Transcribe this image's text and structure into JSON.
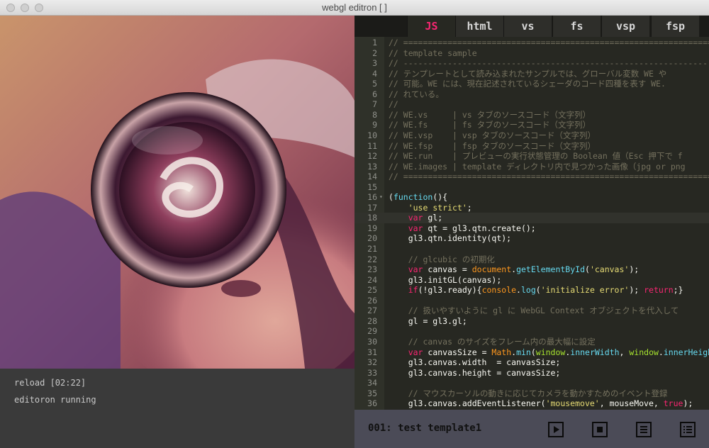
{
  "window": {
    "title": "webgl editron [                                                    ]"
  },
  "status": {
    "line1": "reload [02:22]",
    "line2": "editoron running"
  },
  "tabs": [
    {
      "label": "JS",
      "active": true
    },
    {
      "label": "html",
      "active": false
    },
    {
      "label": "vs",
      "active": false
    },
    {
      "label": "fs",
      "active": false
    },
    {
      "label": "vsp",
      "active": false
    },
    {
      "label": "fsp",
      "active": false
    }
  ],
  "editor": {
    "highlighted_line": 18,
    "lines": [
      {
        "n": "1",
        "c": "// =========================================================================="
      },
      {
        "n": "2",
        "c": "// template sample"
      },
      {
        "n": "3",
        "c": "// --------------------------------------------------------------------------"
      },
      {
        "n": "4",
        "c": "// テンプレートとして読み込まれたサンプルでは、グローバル変数 WE や"
      },
      {
        "n": "5",
        "c": "// 可能。WE には、現在記述されているシェーダのコード四種を表す WE."
      },
      {
        "n": "6",
        "c": "// れている。"
      },
      {
        "n": "7",
        "c": "//"
      },
      {
        "n": "8",
        "c": "// WE.vs     | vs タブのソースコード（文字列）"
      },
      {
        "n": "9",
        "c": "// WE.fs     | fs タブのソースコード（文字列）"
      },
      {
        "n": "10",
        "c": "// WE.vsp    | vsp タブのソースコード（文字列）"
      },
      {
        "n": "11",
        "c": "// WE.fsp    | fsp タブのソースコード（文字列）"
      },
      {
        "n": "12",
        "c": "// WE.run    | プレビューの実行状態管理の Boolean 値（Esc 押下で f"
      },
      {
        "n": "13",
        "c": "// WE.images | template ディレクトリ内で見つかった画像（jpg or png"
      },
      {
        "n": "14",
        "c": "// =========================================================================="
      },
      {
        "n": "15",
        "c": ""
      },
      {
        "n": "16",
        "c": "(function(){"
      },
      {
        "n": "17",
        "c": "    'use strict';"
      },
      {
        "n": "18",
        "c": "    var gl;"
      },
      {
        "n": "19",
        "c": "    var qt = gl3.qtn.create();"
      },
      {
        "n": "20",
        "c": "    gl3.qtn.identity(qt);"
      },
      {
        "n": "21",
        "c": ""
      },
      {
        "n": "22",
        "c": "    // glcubic の初期化"
      },
      {
        "n": "23",
        "c": "    var canvas = document.getElementById('canvas');"
      },
      {
        "n": "24",
        "c": "    gl3.initGL(canvas);"
      },
      {
        "n": "25",
        "c": "    if(!gl3.ready){console.log('initialize error'); return;}"
      },
      {
        "n": "26",
        "c": ""
      },
      {
        "n": "27",
        "c": "    // 扱いやすいように gl に WebGL Context オブジェクトを代入して"
      },
      {
        "n": "28",
        "c": "    gl = gl3.gl;"
      },
      {
        "n": "29",
        "c": ""
      },
      {
        "n": "30",
        "c": "    // canvas のサイズをフレーム内の最大幅に設定"
      },
      {
        "n": "31",
        "c": "    var canvasSize = Math.min(window.innerWidth, window.innerHeight"
      },
      {
        "n": "32",
        "c": "    gl3.canvas.width  = canvasSize;"
      },
      {
        "n": "33",
        "c": "    gl3.canvas.height = canvasSize;"
      },
      {
        "n": "34",
        "c": ""
      },
      {
        "n": "35",
        "c": "    // マウスカーソルの動きに応じてカメラを動かすためのイベント登録"
      },
      {
        "n": "36",
        "c": "    gl3.canvas.addEventListener('mousemove', mouseMove, true);"
      }
    ]
  },
  "toolbar": {
    "label": "001: test template1",
    "buttons": [
      {
        "name": "play-button",
        "icon": "play-icon"
      },
      {
        "name": "stop-button",
        "icon": "stop-icon"
      },
      {
        "name": "menu-button",
        "icon": "list-icon"
      },
      {
        "name": "template-list-button",
        "icon": "numbered-list-icon"
      }
    ]
  }
}
